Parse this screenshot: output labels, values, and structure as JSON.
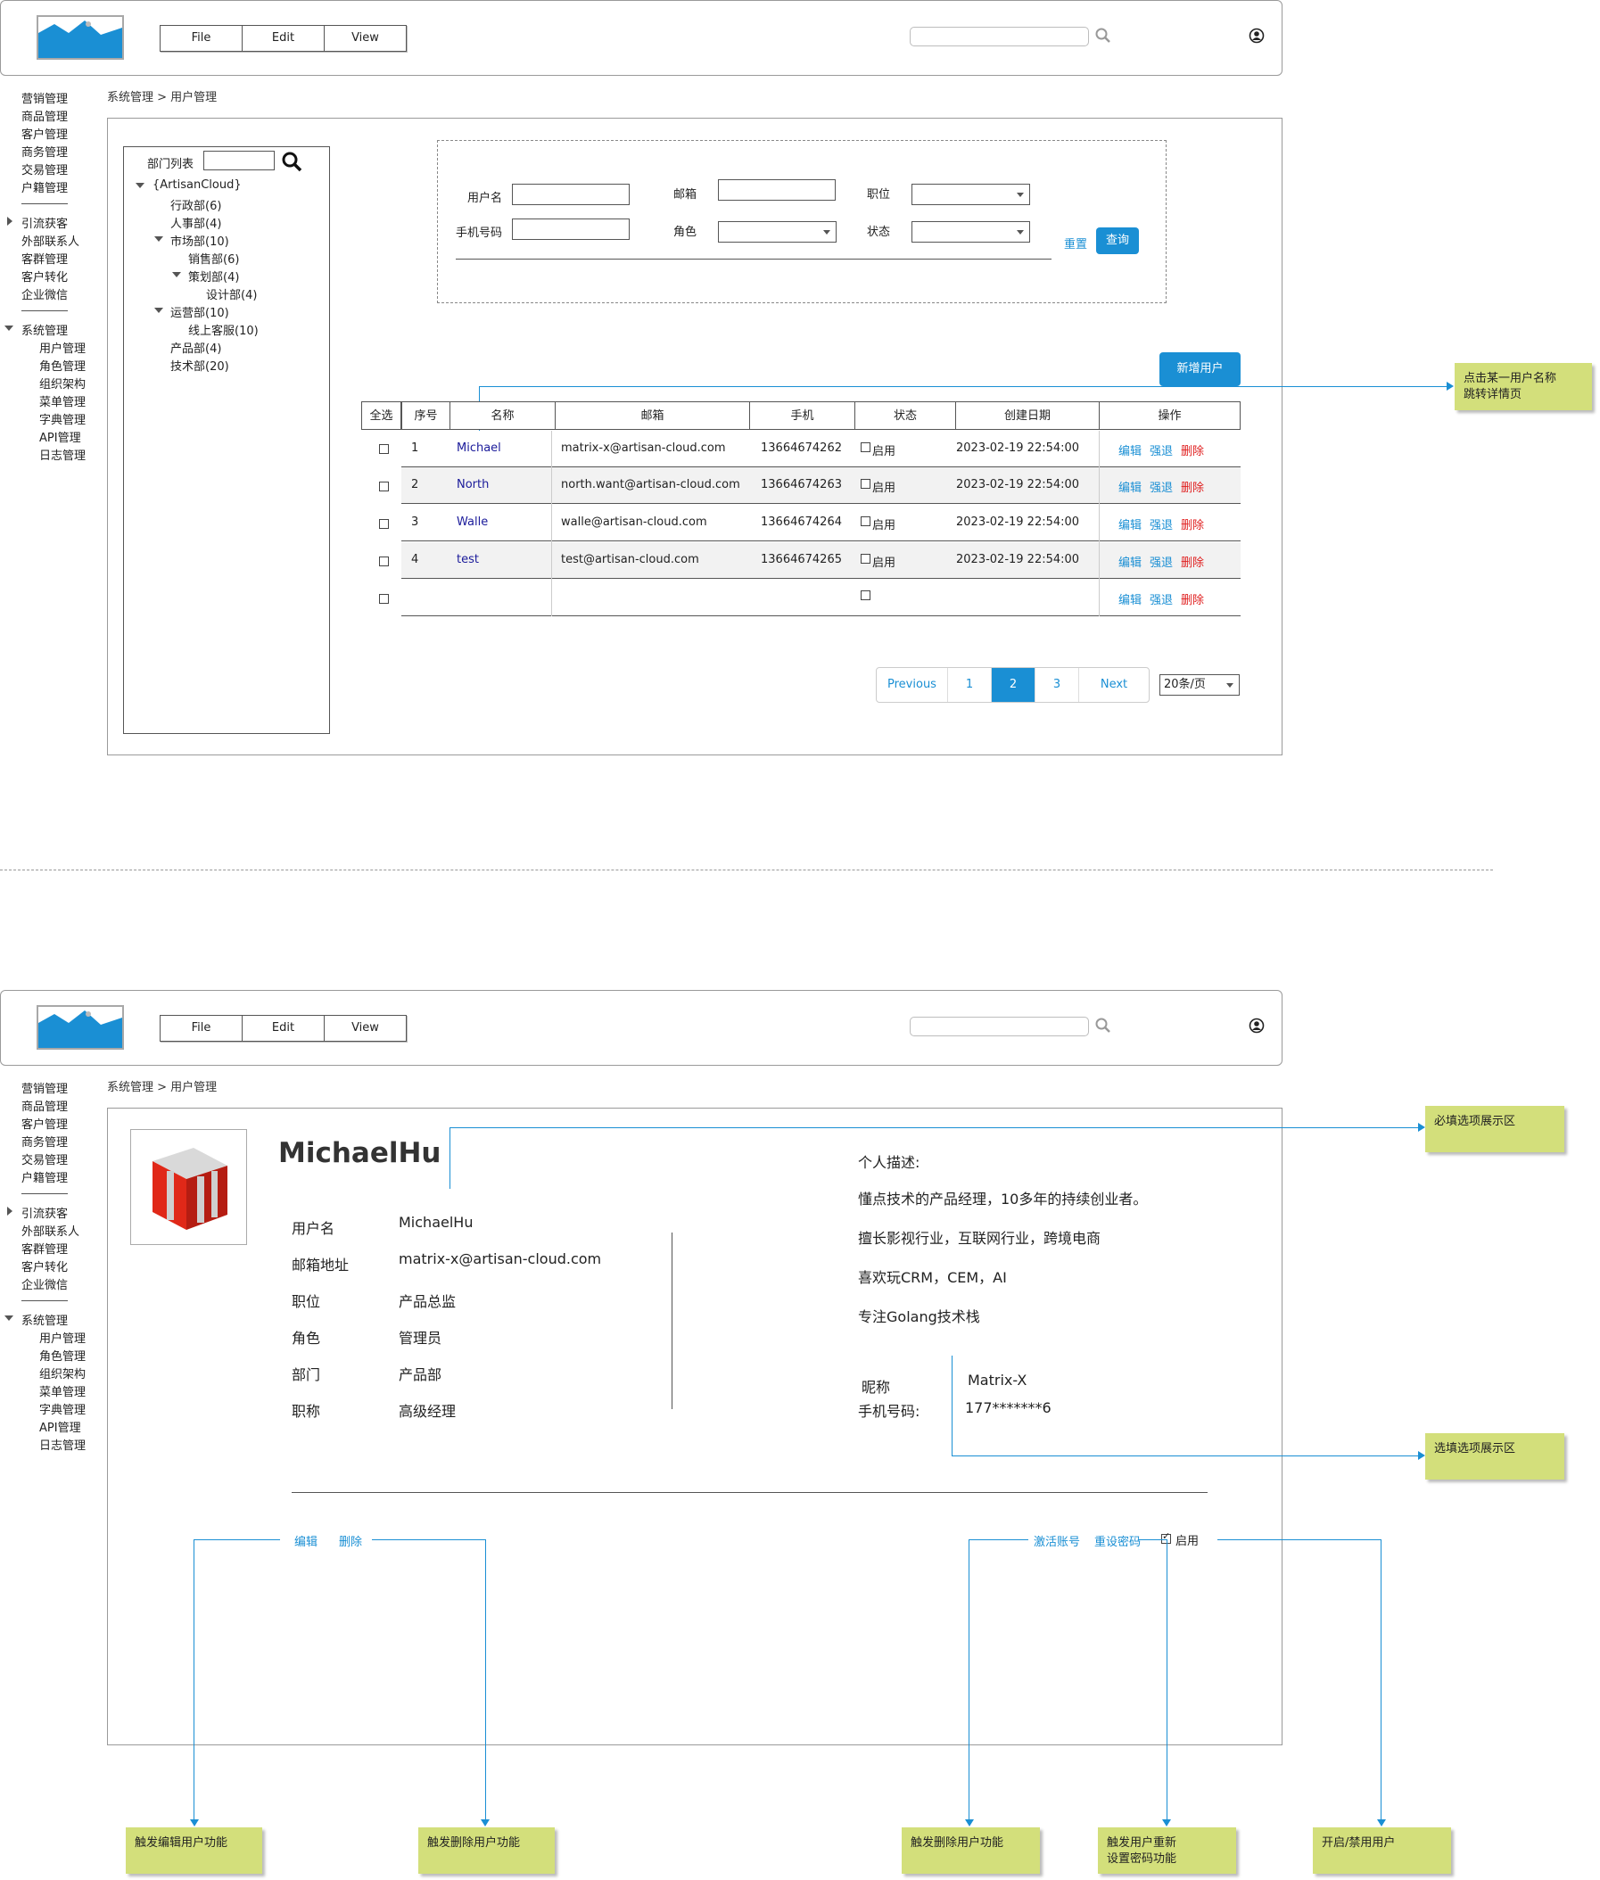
{
  "header": {
    "menu": [
      "File",
      "Edit",
      "View"
    ],
    "search_placeholder": ""
  },
  "sidebar": {
    "group1": [
      "营销管理",
      "商品管理",
      "客户管理",
      "商务管理",
      "交易管理",
      "户籍管理"
    ],
    "group2": [
      "引流获客",
      "外部联系人",
      "客群管理",
      "客户转化",
      "企业微信"
    ],
    "group3_title": "系统管理",
    "group3": [
      "用户管理",
      "角色管理",
      "组织架构",
      "菜单管理",
      "字典管理",
      "API管理",
      "日志管理"
    ]
  },
  "breadcrumb": "系统管理 > 用户管理",
  "tree": {
    "title": "部门列表",
    "items": [
      "{ArtisanCloud}",
      "行政部(6)",
      "人事部(4)",
      "市场部(10)",
      "销售部(6)",
      "策划部(4)",
      "设计部(4)",
      "运营部(10)",
      "线上客服(10)",
      "产品部(4)",
      "技术部(20)"
    ]
  },
  "filter": {
    "username_label": "用户名",
    "email_label": "邮箱",
    "position_label": "职位",
    "phone_label": "手机号码",
    "role_label": "角色",
    "status_label": "状态",
    "reset": "重置",
    "query": "查询"
  },
  "add_user": "新增用户",
  "table": {
    "headers": [
      "全选",
      "序号",
      "名称",
      "邮箱",
      "手机",
      "状态",
      "创建日期",
      "操作"
    ],
    "rows": [
      {
        "no": "1",
        "name": "Michael",
        "email": "matrix-x@artisan-cloud.com",
        "phone": "13664674262",
        "status": "启用",
        "date": "2023-02-19 22:54:00"
      },
      {
        "no": "2",
        "name": "North",
        "email": "north.want@artisan-cloud.com",
        "phone": "13664674263",
        "status": "启用",
        "date": "2023-02-19 22:54:00"
      },
      {
        "no": "3",
        "name": "Walle",
        "email": "walle@artisan-cloud.com",
        "phone": "13664674264",
        "status": "启用",
        "date": "2023-02-19 22:54:00"
      },
      {
        "no": "4",
        "name": "test",
        "email": "test@artisan-cloud.com",
        "phone": "13664674265",
        "status": "启用",
        "date": "2023-02-19 22:54:00"
      },
      {
        "no": "",
        "name": "",
        "email": "",
        "phone": "",
        "status": "",
        "date": ""
      }
    ],
    "actions": {
      "edit": "编辑",
      "force": "强退",
      "delete": "删除"
    }
  },
  "pager": {
    "prev": "Previous",
    "pages": [
      "1",
      "2",
      "3"
    ],
    "active": "2",
    "next": "Next",
    "page_size": "20条/页"
  },
  "notes": {
    "click_name": "点击某一用户名称\n跳转详情页",
    "required": "必填选项展示区",
    "optional": "选填选项展示区",
    "edit_fn": "触发编辑用户功能",
    "delete_fn": "触发删除用户功能",
    "delete_fn2": "触发删除用户功能",
    "reset_pwd_fn": "触发用户重新\n设置密码功能",
    "toggle_fn": "开启/禁用用户"
  },
  "detail": {
    "name": "MichaelHu",
    "fields": [
      {
        "label": "用户名",
        "value": "MichaelHu"
      },
      {
        "label": "邮箱地址",
        "value": "matrix-x@artisan-cloud.com"
      },
      {
        "label": "职位",
        "value": "产品总监"
      },
      {
        "label": "角色",
        "value": "管理员"
      },
      {
        "label": "部门",
        "value": "产品部"
      },
      {
        "label": "职称",
        "value": "高级经理"
      }
    ],
    "desc_title": "个人描述:",
    "desc_lines": [
      "懂点技术的产品经理，10多年的持续创业者。",
      "擅长影视行业，互联网行业，跨境电商",
      "喜欢玩CRM，CEM，AI",
      "专注Golang技术栈"
    ],
    "nickname_label": "昵称",
    "nickname": "Matrix-X",
    "phone_label": "手机号码:",
    "phone": "177*******6",
    "actions": {
      "edit": "编辑",
      "delete": "删除",
      "activate": "激活账号",
      "reset_pwd": "重设密码",
      "enabled": "启用"
    }
  },
  "colors": {
    "accent": "#1a8fd4",
    "danger": "#e02020",
    "note_bg": "#d3df7b",
    "link_name": "#1a1a9a"
  }
}
